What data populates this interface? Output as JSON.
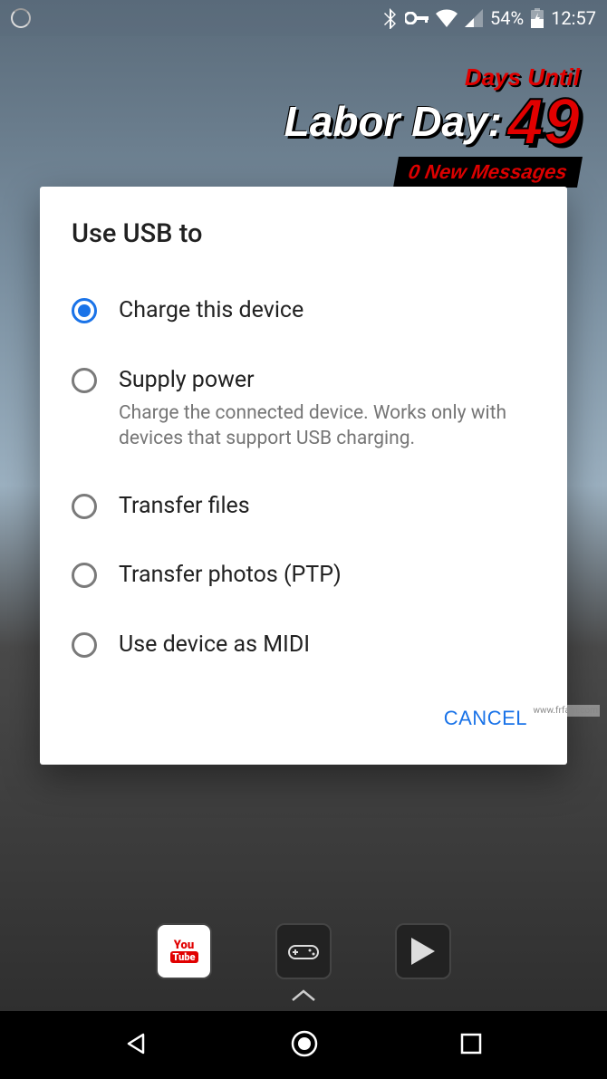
{
  "status_bar": {
    "battery_pct": "54%",
    "time": "12:57"
  },
  "widget": {
    "days_until_label": "Days Until",
    "event_label": "Labor Day:",
    "days_count": "49",
    "messages_label": "0 New Messages"
  },
  "dialog": {
    "title": "Use USB to",
    "options": [
      {
        "label": "Charge this device",
        "selected": true
      },
      {
        "label": "Supply power",
        "desc": "Charge the connected device. Works only with devices that support USB charging.",
        "selected": false
      },
      {
        "label": "Transfer files",
        "selected": false
      },
      {
        "label": "Transfer photos (PTP)",
        "selected": false
      },
      {
        "label": "Use device as MIDI",
        "selected": false
      }
    ],
    "cancel_label": "CANCEL"
  },
  "watermark": "www.frfam.com"
}
